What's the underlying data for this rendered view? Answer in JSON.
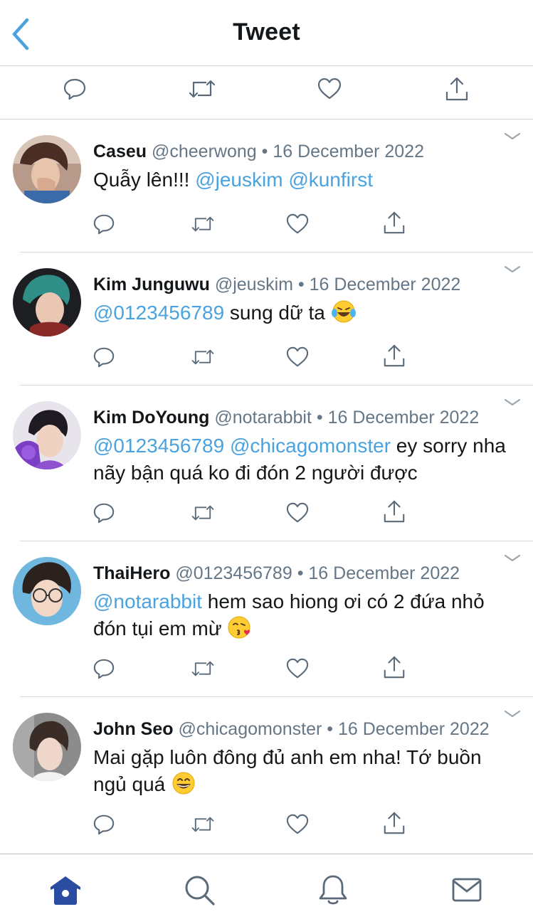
{
  "header": {
    "title": "Tweet",
    "back_icon": "chevron-left-icon"
  },
  "main_actions": [
    {
      "icon": "reply-icon"
    },
    {
      "icon": "retweet-icon"
    },
    {
      "icon": "like-icon"
    },
    {
      "icon": "share-icon"
    }
  ],
  "replies": [
    {
      "name": "Caseu",
      "handle": "@cheerwong",
      "separator": "•",
      "date": "16 December 2022",
      "segments": [
        {
          "text": "Quẫy lên!!! ",
          "mention": false
        },
        {
          "text": "@jeuskim",
          "mention": true
        },
        {
          "text": " ",
          "mention": false
        },
        {
          "text": "@kunfirst",
          "mention": true
        }
      ],
      "emoji": ""
    },
    {
      "name": "Kim Junguwu",
      "handle": "@jeuskim",
      "separator": "•",
      "date": "16 December 2022",
      "segments": [
        {
          "text": "@0123456789",
          "mention": true
        },
        {
          "text": " sung dữ ta ",
          "mention": false
        }
      ],
      "emoji": "laughing-tears-emoji"
    },
    {
      "name": "Kim DoYoung",
      "handle": "@notarabbit",
      "separator": "•",
      "date": "16 December 2022",
      "segments": [
        {
          "text": "@0123456789",
          "mention": true
        },
        {
          "text": " ",
          "mention": false
        },
        {
          "text": "@chicagomonster",
          "mention": true
        },
        {
          "text": " ey sorry nha nãy bận quá ko đi đón 2 người được",
          "mention": false
        }
      ],
      "emoji": ""
    },
    {
      "name": "ThaiHero",
      "handle": "@0123456789",
      "separator": "•",
      "date": "16 December 2022",
      "segments": [
        {
          "text": "@notarabbit",
          "mention": true
        },
        {
          "text": " hem sao hiong ơi có 2 đứa nhỏ đón tụi em mừ ",
          "mention": false
        }
      ],
      "emoji": "kissing-heart-emoji"
    },
    {
      "name": "John Seo",
      "handle": "@chicagomonster",
      "separator": "•",
      "date": "16 December 2022",
      "segments": [
        {
          "text": "Mai gặp luôn đông đủ anh em nha! Tớ buồn ngủ quá ",
          "mention": false
        }
      ],
      "emoji": "grinning-emoji"
    }
  ],
  "tabbar": [
    {
      "icon": "home-icon",
      "active": true
    },
    {
      "icon": "search-icon",
      "active": false
    },
    {
      "icon": "notifications-icon",
      "active": false
    },
    {
      "icon": "messages-icon",
      "active": false
    }
  ],
  "colors": {
    "accent": "#1da1f2",
    "mention": "#4aa3df",
    "secondary_text": "#657786",
    "icon": "#5a6a78",
    "tab_active": "#2a4da1"
  }
}
